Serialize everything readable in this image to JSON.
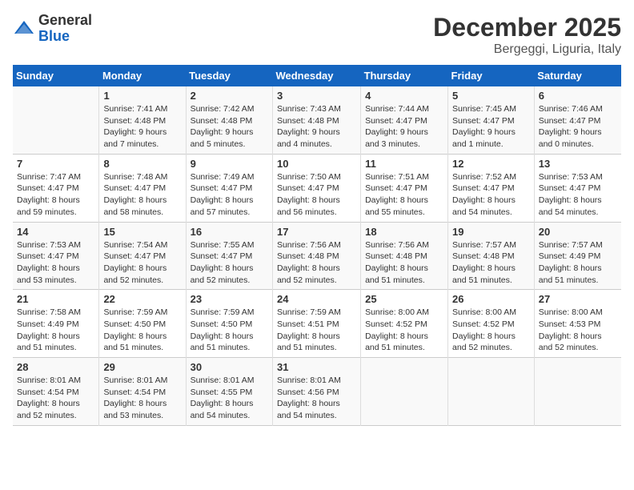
{
  "logo": {
    "general": "General",
    "blue": "Blue"
  },
  "title": "December 2025",
  "subtitle": "Bergeggi, Liguria, Italy",
  "days_header": [
    "Sunday",
    "Monday",
    "Tuesday",
    "Wednesday",
    "Thursday",
    "Friday",
    "Saturday"
  ],
  "weeks": [
    [
      {
        "day": "",
        "info": ""
      },
      {
        "day": "1",
        "info": "Sunrise: 7:41 AM\nSunset: 4:48 PM\nDaylight: 9 hours\nand 7 minutes."
      },
      {
        "day": "2",
        "info": "Sunrise: 7:42 AM\nSunset: 4:48 PM\nDaylight: 9 hours\nand 5 minutes."
      },
      {
        "day": "3",
        "info": "Sunrise: 7:43 AM\nSunset: 4:48 PM\nDaylight: 9 hours\nand 4 minutes."
      },
      {
        "day": "4",
        "info": "Sunrise: 7:44 AM\nSunset: 4:47 PM\nDaylight: 9 hours\nand 3 minutes."
      },
      {
        "day": "5",
        "info": "Sunrise: 7:45 AM\nSunset: 4:47 PM\nDaylight: 9 hours\nand 1 minute."
      },
      {
        "day": "6",
        "info": "Sunrise: 7:46 AM\nSunset: 4:47 PM\nDaylight: 9 hours\nand 0 minutes."
      }
    ],
    [
      {
        "day": "7",
        "info": "Sunrise: 7:47 AM\nSunset: 4:47 PM\nDaylight: 8 hours\nand 59 minutes."
      },
      {
        "day": "8",
        "info": "Sunrise: 7:48 AM\nSunset: 4:47 PM\nDaylight: 8 hours\nand 58 minutes."
      },
      {
        "day": "9",
        "info": "Sunrise: 7:49 AM\nSunset: 4:47 PM\nDaylight: 8 hours\nand 57 minutes."
      },
      {
        "day": "10",
        "info": "Sunrise: 7:50 AM\nSunset: 4:47 PM\nDaylight: 8 hours\nand 56 minutes."
      },
      {
        "day": "11",
        "info": "Sunrise: 7:51 AM\nSunset: 4:47 PM\nDaylight: 8 hours\nand 55 minutes."
      },
      {
        "day": "12",
        "info": "Sunrise: 7:52 AM\nSunset: 4:47 PM\nDaylight: 8 hours\nand 54 minutes."
      },
      {
        "day": "13",
        "info": "Sunrise: 7:53 AM\nSunset: 4:47 PM\nDaylight: 8 hours\nand 54 minutes."
      }
    ],
    [
      {
        "day": "14",
        "info": "Sunrise: 7:53 AM\nSunset: 4:47 PM\nDaylight: 8 hours\nand 53 minutes."
      },
      {
        "day": "15",
        "info": "Sunrise: 7:54 AM\nSunset: 4:47 PM\nDaylight: 8 hours\nand 52 minutes."
      },
      {
        "day": "16",
        "info": "Sunrise: 7:55 AM\nSunset: 4:47 PM\nDaylight: 8 hours\nand 52 minutes."
      },
      {
        "day": "17",
        "info": "Sunrise: 7:56 AM\nSunset: 4:48 PM\nDaylight: 8 hours\nand 52 minutes."
      },
      {
        "day": "18",
        "info": "Sunrise: 7:56 AM\nSunset: 4:48 PM\nDaylight: 8 hours\nand 51 minutes."
      },
      {
        "day": "19",
        "info": "Sunrise: 7:57 AM\nSunset: 4:48 PM\nDaylight: 8 hours\nand 51 minutes."
      },
      {
        "day": "20",
        "info": "Sunrise: 7:57 AM\nSunset: 4:49 PM\nDaylight: 8 hours\nand 51 minutes."
      }
    ],
    [
      {
        "day": "21",
        "info": "Sunrise: 7:58 AM\nSunset: 4:49 PM\nDaylight: 8 hours\nand 51 minutes."
      },
      {
        "day": "22",
        "info": "Sunrise: 7:59 AM\nSunset: 4:50 PM\nDaylight: 8 hours\nand 51 minutes."
      },
      {
        "day": "23",
        "info": "Sunrise: 7:59 AM\nSunset: 4:50 PM\nDaylight: 8 hours\nand 51 minutes."
      },
      {
        "day": "24",
        "info": "Sunrise: 7:59 AM\nSunset: 4:51 PM\nDaylight: 8 hours\nand 51 minutes."
      },
      {
        "day": "25",
        "info": "Sunrise: 8:00 AM\nSunset: 4:52 PM\nDaylight: 8 hours\nand 51 minutes."
      },
      {
        "day": "26",
        "info": "Sunrise: 8:00 AM\nSunset: 4:52 PM\nDaylight: 8 hours\nand 52 minutes."
      },
      {
        "day": "27",
        "info": "Sunrise: 8:00 AM\nSunset: 4:53 PM\nDaylight: 8 hours\nand 52 minutes."
      }
    ],
    [
      {
        "day": "28",
        "info": "Sunrise: 8:01 AM\nSunset: 4:54 PM\nDaylight: 8 hours\nand 52 minutes."
      },
      {
        "day": "29",
        "info": "Sunrise: 8:01 AM\nSunset: 4:54 PM\nDaylight: 8 hours\nand 53 minutes."
      },
      {
        "day": "30",
        "info": "Sunrise: 8:01 AM\nSunset: 4:55 PM\nDaylight: 8 hours\nand 54 minutes."
      },
      {
        "day": "31",
        "info": "Sunrise: 8:01 AM\nSunset: 4:56 PM\nDaylight: 8 hours\nand 54 minutes."
      },
      {
        "day": "",
        "info": ""
      },
      {
        "day": "",
        "info": ""
      },
      {
        "day": "",
        "info": ""
      }
    ]
  ]
}
